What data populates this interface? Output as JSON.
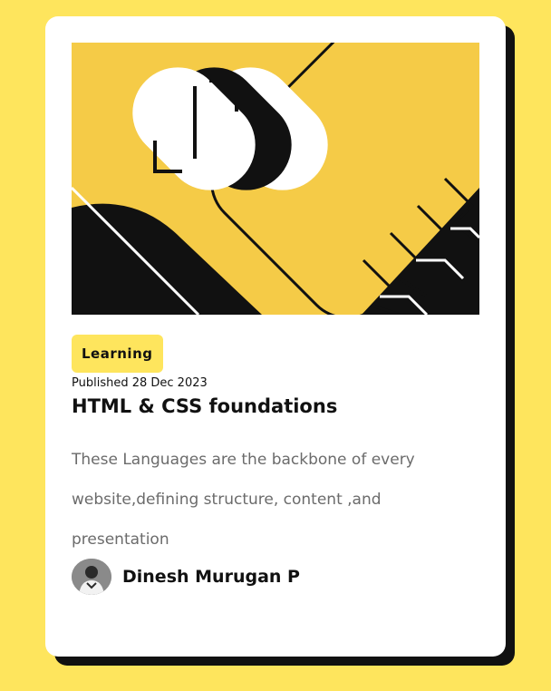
{
  "card": {
    "tag": "Learning",
    "published": "Published 28 Dec 2023",
    "title": "HTML & CSS foundations",
    "description": "These Languages are the backbone of every website,defining structure, content ,and presentation",
    "author": "Dinesh Murugan P"
  },
  "colors": {
    "background": "#FEE55D",
    "card": "#FFFFFF",
    "shadow": "#111111",
    "tag_bg": "#FEE55D",
    "hero_bg": "#F5CB47",
    "text_primary": "#111111",
    "text_secondary": "#6B6B6B"
  },
  "icons": {
    "hero": "abstract-illustration",
    "avatar": "author-avatar"
  }
}
